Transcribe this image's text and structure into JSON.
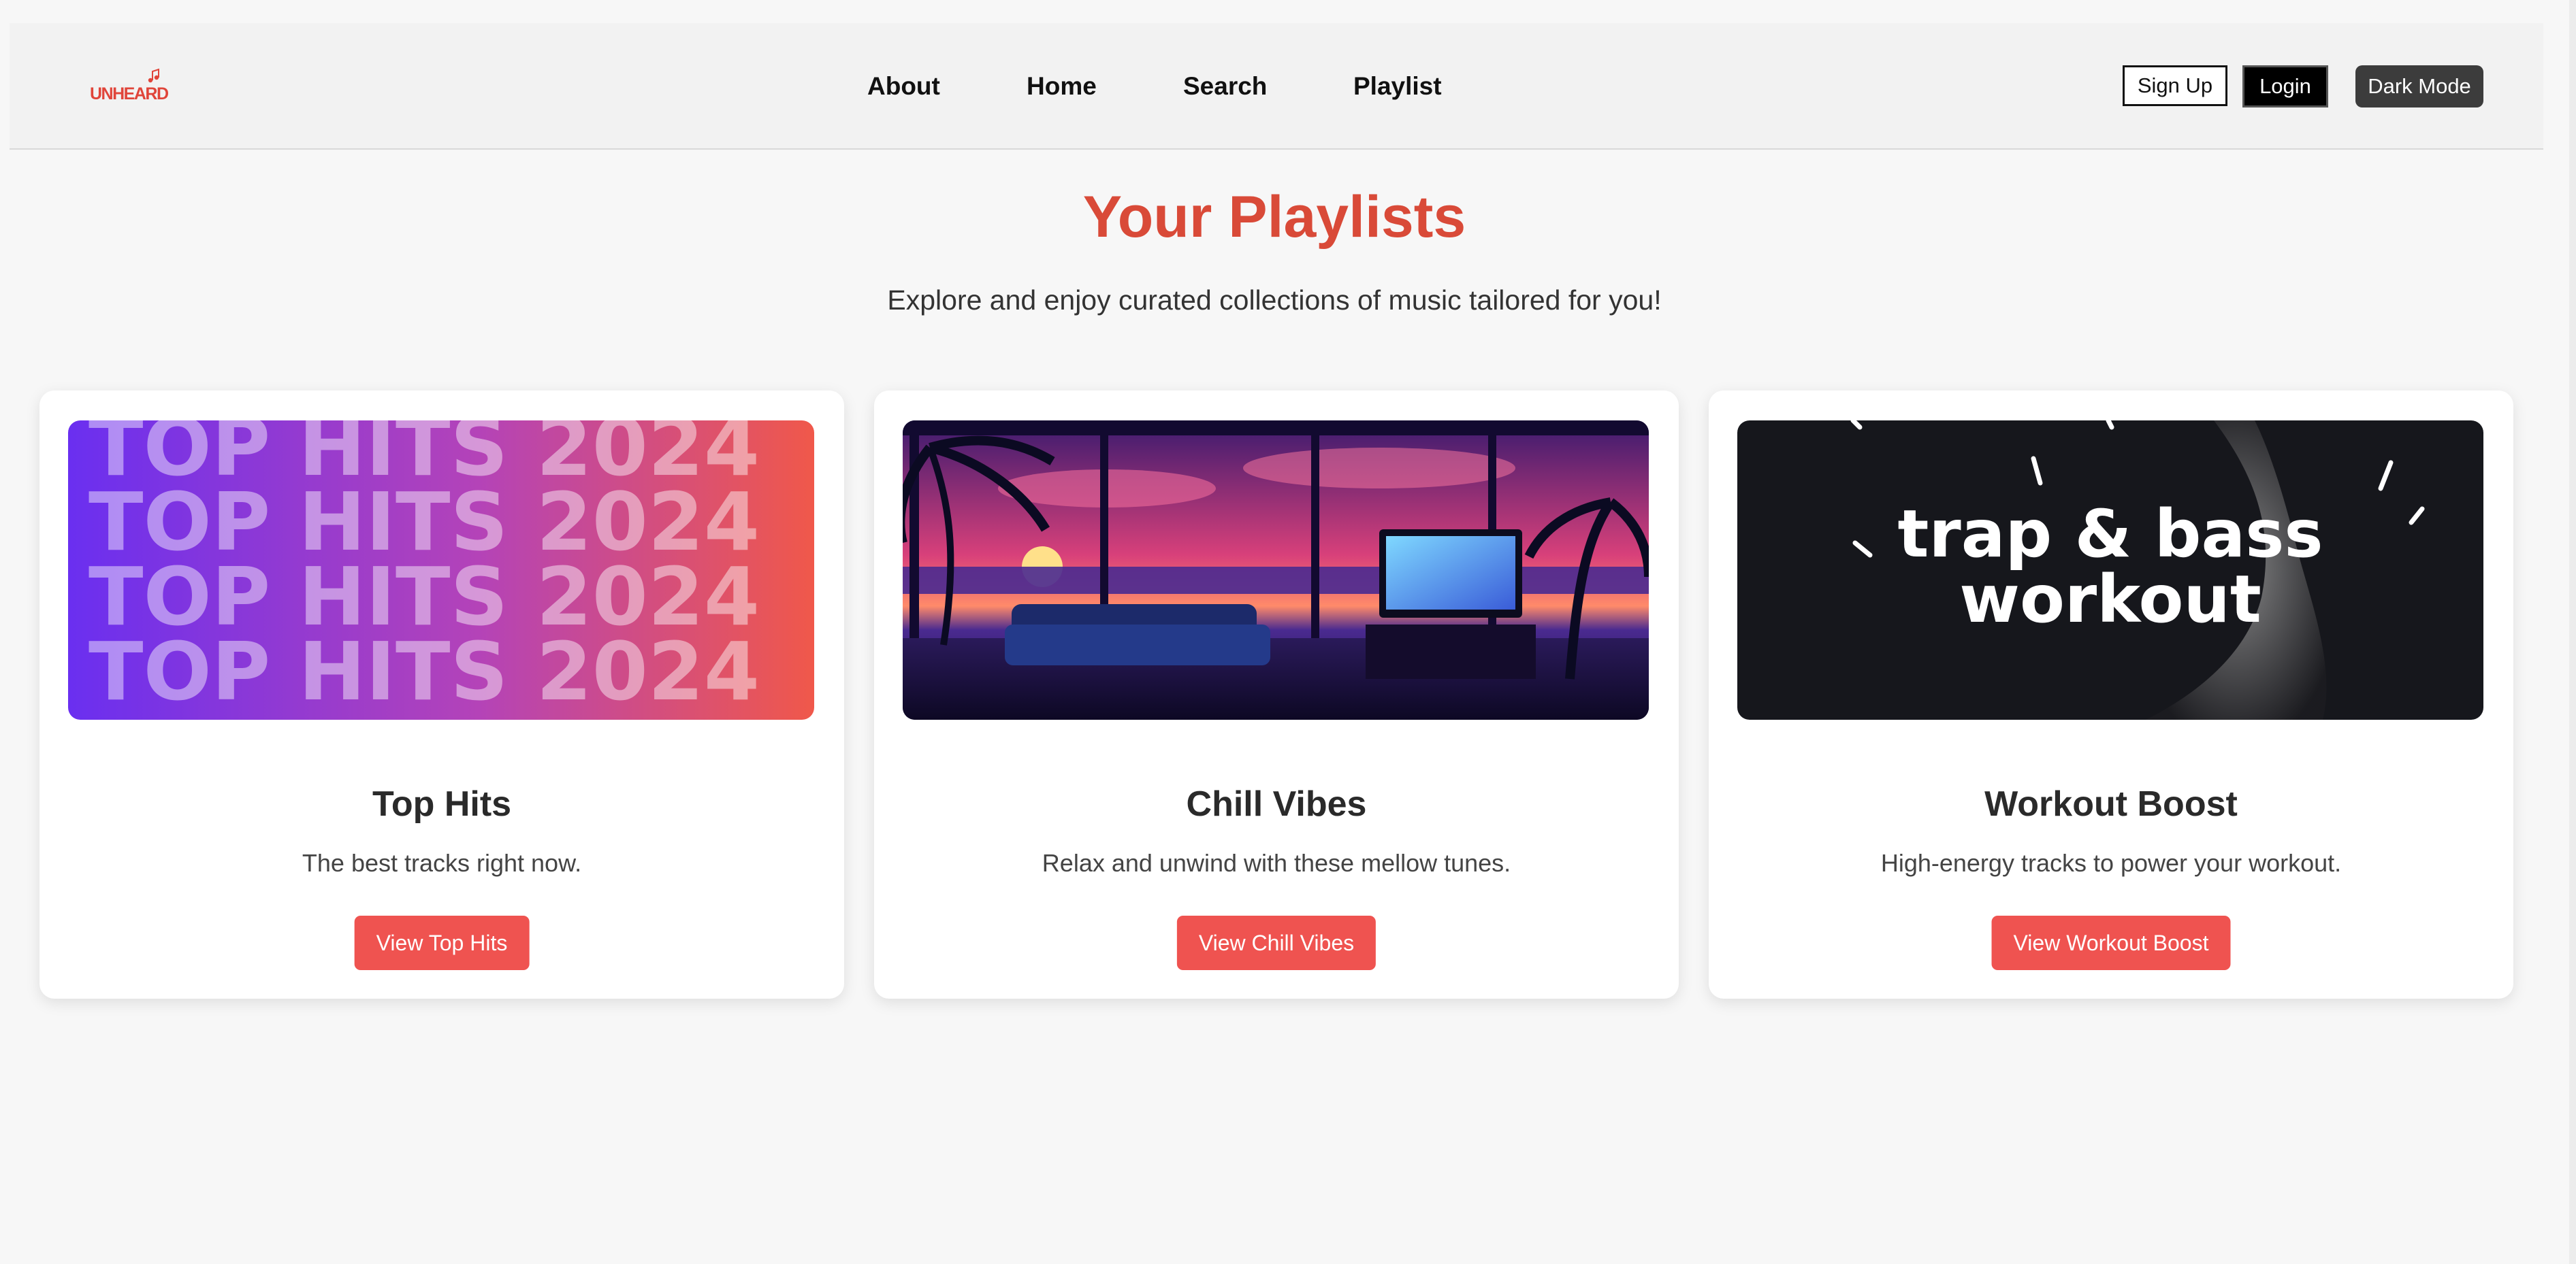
{
  "brand": {
    "logo_text": "UNHEARD",
    "accent_color": "#e0453a"
  },
  "nav": {
    "links": [
      {
        "label": "About"
      },
      {
        "label": "Home"
      },
      {
        "label": "Search"
      },
      {
        "label": "Playlist"
      }
    ],
    "signup_label": "Sign Up",
    "login_label": "Login",
    "dark_mode_label": "Dark Mode"
  },
  "hero": {
    "title": "Your Playlists",
    "subtitle": "Explore and enjoy curated collections of music tailored for you!",
    "title_color": "#d94a38"
  },
  "playlists": [
    {
      "title": "Top Hits",
      "description": "The best tracks right now.",
      "button_label": "View Top Hits",
      "cover_text": "TOP HITS 2024"
    },
    {
      "title": "Chill Vibes",
      "description": "Relax and unwind with these mellow tunes.",
      "button_label": "View Chill Vibes"
    },
    {
      "title": "Workout Boost",
      "description": "High-energy tracks to power your workout.",
      "button_label": "View Workout Boost",
      "cover_text_line1": "trap & bass",
      "cover_text_line2": "workout"
    }
  ],
  "button_color": "#ef5350"
}
